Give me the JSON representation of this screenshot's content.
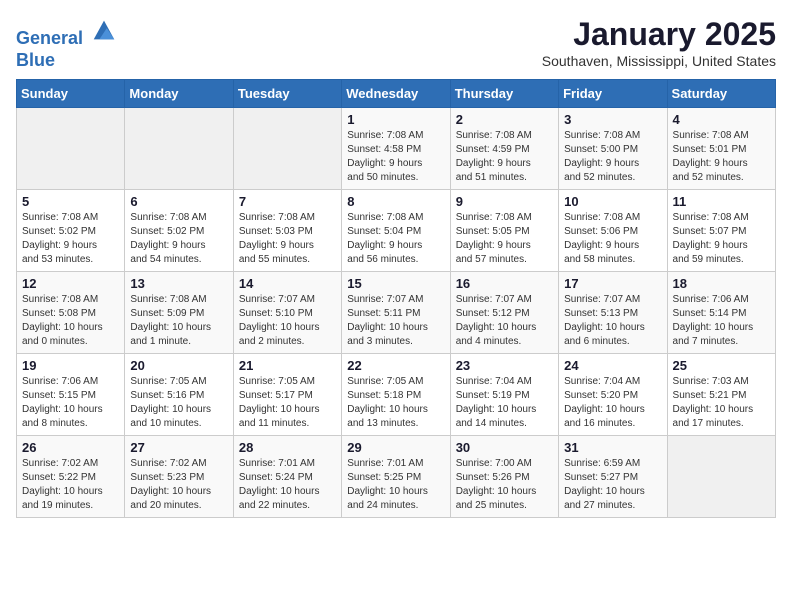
{
  "header": {
    "logo_line1": "General",
    "logo_line2": "Blue",
    "month_title": "January 2025",
    "location": "Southaven, Mississippi, United States"
  },
  "weekdays": [
    "Sunday",
    "Monday",
    "Tuesday",
    "Wednesday",
    "Thursday",
    "Friday",
    "Saturday"
  ],
  "weeks": [
    [
      {
        "day": "",
        "info": ""
      },
      {
        "day": "",
        "info": ""
      },
      {
        "day": "",
        "info": ""
      },
      {
        "day": "1",
        "info": "Sunrise: 7:08 AM\nSunset: 4:58 PM\nDaylight: 9 hours\nand 50 minutes."
      },
      {
        "day": "2",
        "info": "Sunrise: 7:08 AM\nSunset: 4:59 PM\nDaylight: 9 hours\nand 51 minutes."
      },
      {
        "day": "3",
        "info": "Sunrise: 7:08 AM\nSunset: 5:00 PM\nDaylight: 9 hours\nand 52 minutes."
      },
      {
        "day": "4",
        "info": "Sunrise: 7:08 AM\nSunset: 5:01 PM\nDaylight: 9 hours\nand 52 minutes."
      }
    ],
    [
      {
        "day": "5",
        "info": "Sunrise: 7:08 AM\nSunset: 5:02 PM\nDaylight: 9 hours\nand 53 minutes."
      },
      {
        "day": "6",
        "info": "Sunrise: 7:08 AM\nSunset: 5:02 PM\nDaylight: 9 hours\nand 54 minutes."
      },
      {
        "day": "7",
        "info": "Sunrise: 7:08 AM\nSunset: 5:03 PM\nDaylight: 9 hours\nand 55 minutes."
      },
      {
        "day": "8",
        "info": "Sunrise: 7:08 AM\nSunset: 5:04 PM\nDaylight: 9 hours\nand 56 minutes."
      },
      {
        "day": "9",
        "info": "Sunrise: 7:08 AM\nSunset: 5:05 PM\nDaylight: 9 hours\nand 57 minutes."
      },
      {
        "day": "10",
        "info": "Sunrise: 7:08 AM\nSunset: 5:06 PM\nDaylight: 9 hours\nand 58 minutes."
      },
      {
        "day": "11",
        "info": "Sunrise: 7:08 AM\nSunset: 5:07 PM\nDaylight: 9 hours\nand 59 minutes."
      }
    ],
    [
      {
        "day": "12",
        "info": "Sunrise: 7:08 AM\nSunset: 5:08 PM\nDaylight: 10 hours\nand 0 minutes."
      },
      {
        "day": "13",
        "info": "Sunrise: 7:08 AM\nSunset: 5:09 PM\nDaylight: 10 hours\nand 1 minute."
      },
      {
        "day": "14",
        "info": "Sunrise: 7:07 AM\nSunset: 5:10 PM\nDaylight: 10 hours\nand 2 minutes."
      },
      {
        "day": "15",
        "info": "Sunrise: 7:07 AM\nSunset: 5:11 PM\nDaylight: 10 hours\nand 3 minutes."
      },
      {
        "day": "16",
        "info": "Sunrise: 7:07 AM\nSunset: 5:12 PM\nDaylight: 10 hours\nand 4 minutes."
      },
      {
        "day": "17",
        "info": "Sunrise: 7:07 AM\nSunset: 5:13 PM\nDaylight: 10 hours\nand 6 minutes."
      },
      {
        "day": "18",
        "info": "Sunrise: 7:06 AM\nSunset: 5:14 PM\nDaylight: 10 hours\nand 7 minutes."
      }
    ],
    [
      {
        "day": "19",
        "info": "Sunrise: 7:06 AM\nSunset: 5:15 PM\nDaylight: 10 hours\nand 8 minutes."
      },
      {
        "day": "20",
        "info": "Sunrise: 7:05 AM\nSunset: 5:16 PM\nDaylight: 10 hours\nand 10 minutes."
      },
      {
        "day": "21",
        "info": "Sunrise: 7:05 AM\nSunset: 5:17 PM\nDaylight: 10 hours\nand 11 minutes."
      },
      {
        "day": "22",
        "info": "Sunrise: 7:05 AM\nSunset: 5:18 PM\nDaylight: 10 hours\nand 13 minutes."
      },
      {
        "day": "23",
        "info": "Sunrise: 7:04 AM\nSunset: 5:19 PM\nDaylight: 10 hours\nand 14 minutes."
      },
      {
        "day": "24",
        "info": "Sunrise: 7:04 AM\nSunset: 5:20 PM\nDaylight: 10 hours\nand 16 minutes."
      },
      {
        "day": "25",
        "info": "Sunrise: 7:03 AM\nSunset: 5:21 PM\nDaylight: 10 hours\nand 17 minutes."
      }
    ],
    [
      {
        "day": "26",
        "info": "Sunrise: 7:02 AM\nSunset: 5:22 PM\nDaylight: 10 hours\nand 19 minutes."
      },
      {
        "day": "27",
        "info": "Sunrise: 7:02 AM\nSunset: 5:23 PM\nDaylight: 10 hours\nand 20 minutes."
      },
      {
        "day": "28",
        "info": "Sunrise: 7:01 AM\nSunset: 5:24 PM\nDaylight: 10 hours\nand 22 minutes."
      },
      {
        "day": "29",
        "info": "Sunrise: 7:01 AM\nSunset: 5:25 PM\nDaylight: 10 hours\nand 24 minutes."
      },
      {
        "day": "30",
        "info": "Sunrise: 7:00 AM\nSunset: 5:26 PM\nDaylight: 10 hours\nand 25 minutes."
      },
      {
        "day": "31",
        "info": "Sunrise: 6:59 AM\nSunset: 5:27 PM\nDaylight: 10 hours\nand 27 minutes."
      },
      {
        "day": "",
        "info": ""
      }
    ]
  ]
}
